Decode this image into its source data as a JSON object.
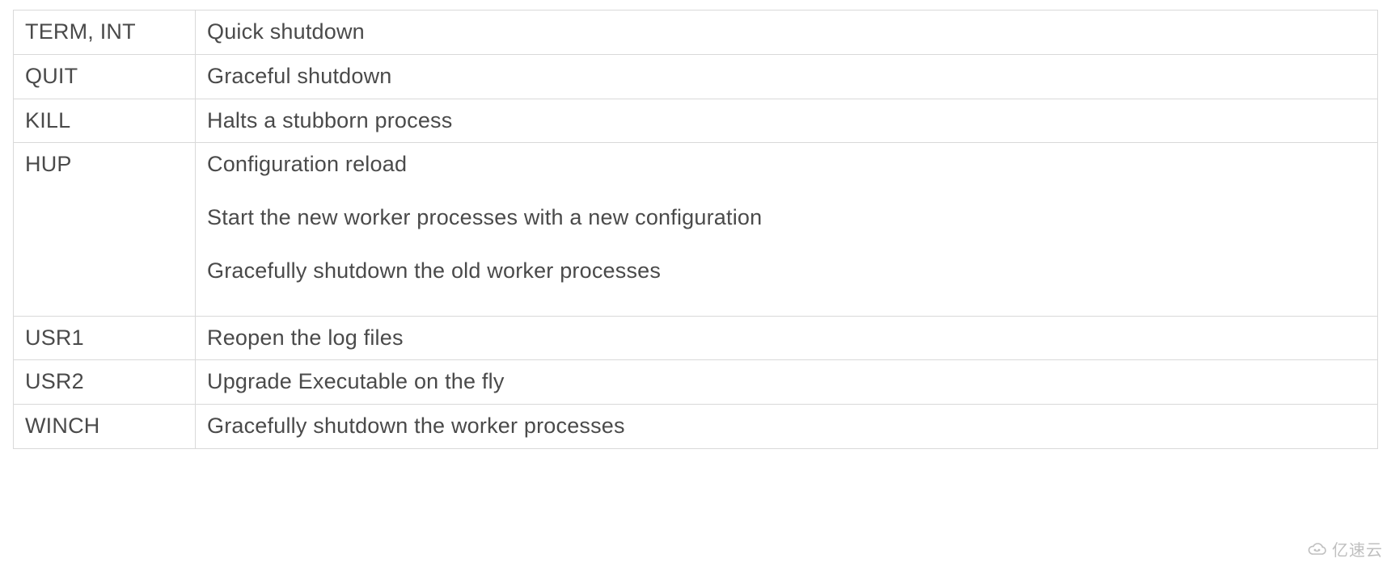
{
  "table": {
    "rows": [
      {
        "signal": "TERM, INT",
        "descriptions": [
          "Quick shutdown"
        ]
      },
      {
        "signal": "QUIT",
        "descriptions": [
          "Graceful shutdown"
        ]
      },
      {
        "signal": "KILL",
        "descriptions": [
          "Halts a stubborn process"
        ]
      },
      {
        "signal": "HUP",
        "descriptions": [
          "Configuration reload",
          "Start the new worker processes with a new configuration",
          "Gracefully shutdown the old worker processes"
        ]
      },
      {
        "signal": "USR1",
        "descriptions": [
          "Reopen the log files"
        ]
      },
      {
        "signal": "USR2",
        "descriptions": [
          "Upgrade Executable on the fly"
        ]
      },
      {
        "signal": "WINCH",
        "descriptions": [
          "Gracefully shutdown the worker processes"
        ]
      }
    ]
  },
  "watermark": {
    "text": "亿速云"
  }
}
